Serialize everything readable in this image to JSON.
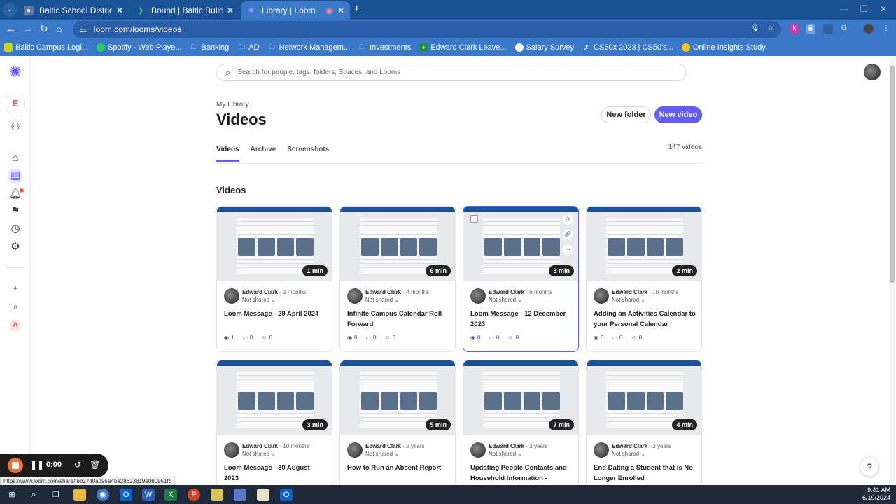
{
  "browser": {
    "tabs": [
      {
        "title": "Baltic School District",
        "active": false
      },
      {
        "title": "Bound | Baltic Bulldogs/Lady Bu",
        "active": false
      },
      {
        "title": "Library | Loom",
        "active": true
      }
    ],
    "url": "loom.com/looms/videos",
    "bookmarks": [
      "Baltic Campus Logi...",
      "Spotify - Web Playe...",
      "Banking",
      "AD",
      "Network Managem...",
      "Investments",
      "Edward Clark Leave...",
      "Salary Survey",
      "CS50x 2023 | CS50's...",
      "Online Insights Study"
    ]
  },
  "sidebar": {
    "workspace_letter": "E",
    "bottom_letter": "A"
  },
  "search": {
    "placeholder": "Search for people, tags, folders, Spaces, and Looms"
  },
  "header": {
    "breadcrumb": "My Library",
    "title": "Videos",
    "new_folder": "New folder",
    "new_video": "New video"
  },
  "tabs": [
    "Videos",
    "Archive",
    "Screenshots"
  ],
  "video_count": "147 videos",
  "section_title": "Videos",
  "videos": [
    {
      "duration": "1 min",
      "author": "Edward Clark",
      "age": "2 months",
      "shared": "Not shared",
      "title": "Loom Message - 29 April 2024",
      "views": "1",
      "comments": "0",
      "reactions": "0"
    },
    {
      "duration": "6 min",
      "author": "Edward Clark",
      "age": "4 months",
      "shared": "Not shared",
      "title": "Infinite Campus Calendar Roll Forward",
      "views": "0",
      "comments": "0",
      "reactions": "0"
    },
    {
      "duration": "3 min",
      "author": "Edward Clark",
      "age": "6 months",
      "shared": "Not shared",
      "title": "Loom Message - 12 December 2023",
      "views": "0",
      "comments": "0",
      "reactions": "0"
    },
    {
      "duration": "2 min",
      "author": "Edward Clark",
      "age": "10 months",
      "shared": "Not shared",
      "title": "Adding an Activities Calendar to your Personal Calendar",
      "views": "0",
      "comments": "0",
      "reactions": "0"
    },
    {
      "duration": "3 min",
      "author": "Edward Clark",
      "age": "10 months",
      "shared": "Not shared",
      "title": "Loom Message - 30 August 2023"
    },
    {
      "duration": "5 min",
      "author": "Edward Clark",
      "age": "2 years",
      "shared": "Not shared",
      "title": "How to Run an Absent Report"
    },
    {
      "duration": "7 min",
      "author": "Edward Clark",
      "age": "2 years",
      "shared": "Not shared",
      "title": "Updating People Contacts and Household Information - Infinit..."
    },
    {
      "duration": "4 min",
      "author": "Edward Clark",
      "age": "2 years",
      "shared": "Not shared",
      "title": "End Dating a Student that is No Longer Enrolled"
    }
  ],
  "recorder": {
    "time": "0:00"
  },
  "status_url": "https://www.loom.com/share/feb2740ad95a4ba28623819e0b0951fc",
  "help_label": "?",
  "clock": {
    "time": "9:41 AM",
    "date": "6/19/2024"
  },
  "colors": {
    "accent": "#625df5",
    "chrome": "#1a5197",
    "record": "#f06d3c"
  }
}
